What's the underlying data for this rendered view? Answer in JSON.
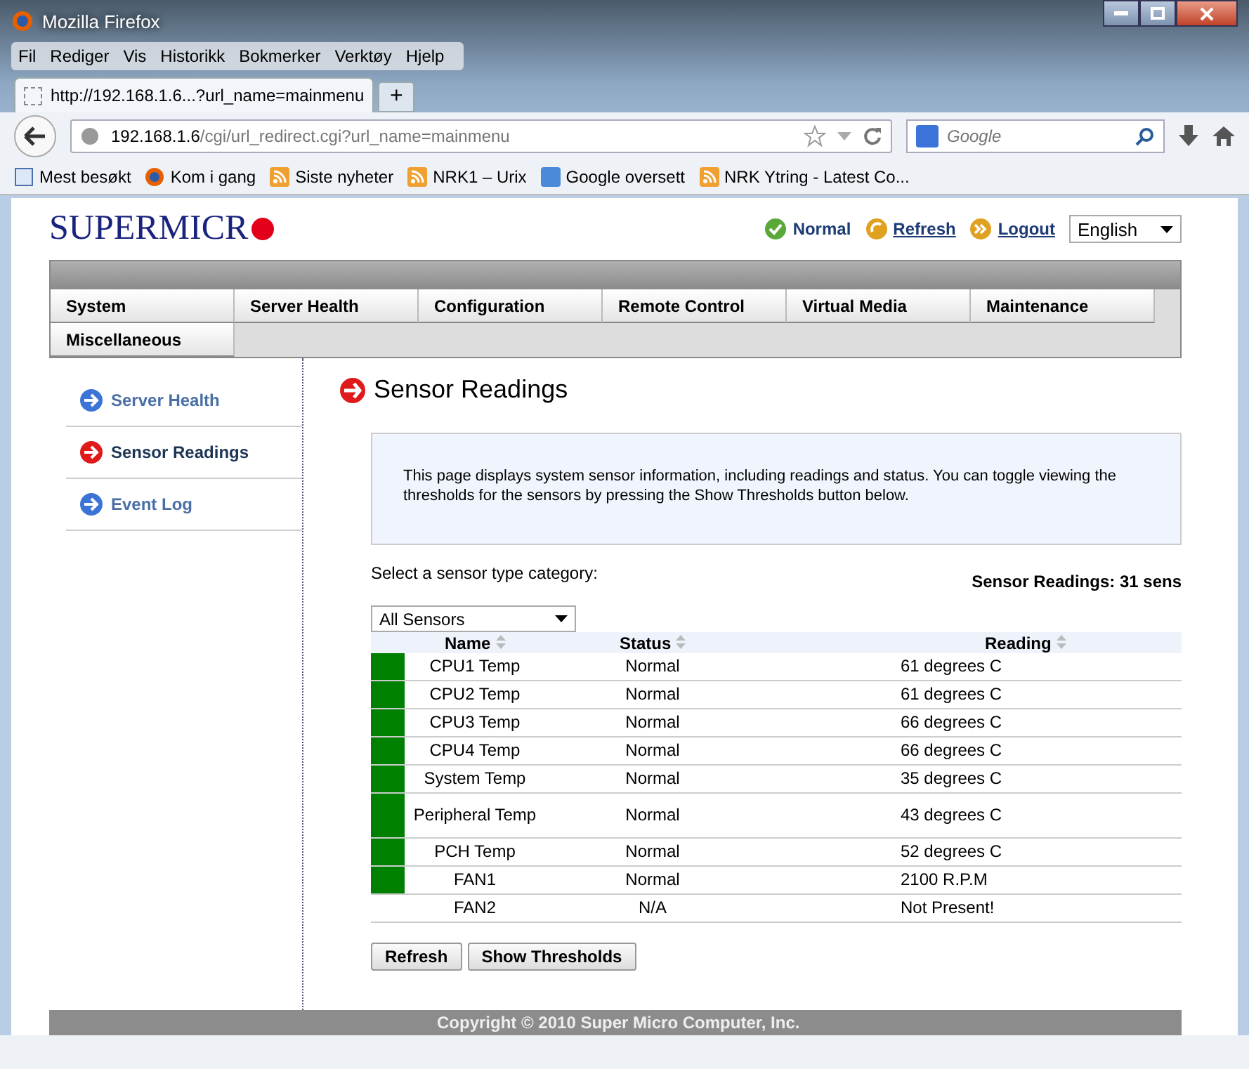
{
  "window": {
    "title": "Mozilla Firefox"
  },
  "menu": [
    "Fil",
    "Rediger",
    "Vis",
    "Historikk",
    "Bokmerker",
    "Verktøy",
    "Hjelp"
  ],
  "tab": {
    "title": "http://192.168.1.6...?url_name=mainmenu",
    "new_tab": "+"
  },
  "address": {
    "host": "192.168.1.6",
    "path": "/cgi/url_redirect.cgi?url_name=mainmenu"
  },
  "search": {
    "placeholder": "Google"
  },
  "bookmarks": [
    {
      "label": "Mest besøkt",
      "kind": "page"
    },
    {
      "label": "Kom i gang",
      "kind": "firefox"
    },
    {
      "label": "Siste nyheter",
      "kind": "feed"
    },
    {
      "label": "NRK1 – Urix",
      "kind": "feed"
    },
    {
      "label": "Google oversett",
      "kind": "translate"
    },
    {
      "label": "NRK Ytring - Latest Co...",
      "kind": "feed"
    }
  ],
  "header": {
    "logo": "SUPERMICR",
    "status": "Normal",
    "refresh": "Refresh",
    "logout": "Logout",
    "language": "English"
  },
  "nav": [
    "System",
    "Server Health",
    "Configuration",
    "Remote Control",
    "Virtual Media",
    "Maintenance",
    "Miscellaneous"
  ],
  "sidebar": {
    "items": [
      {
        "label": "Server Health",
        "selected": false
      },
      {
        "label": "Sensor Readings",
        "selected": true
      },
      {
        "label": "Event Log",
        "selected": false
      }
    ]
  },
  "main": {
    "title": "Sensor Readings",
    "info": "This page displays system sensor information, including readings and status. You can toggle viewing the thresholds for the sensors by pressing the Show Thresholds button below.",
    "category_label": "Select a sensor type category:",
    "count": "Sensor Readings: 31 sens",
    "category": "All Sensors"
  },
  "table": {
    "columns": [
      "Name",
      "Status",
      "Reading"
    ],
    "rows": [
      {
        "name": "CPU1 Temp",
        "status": "Normal",
        "reading": "61 degrees C",
        "color": "#008000"
      },
      {
        "name": "CPU2 Temp",
        "status": "Normal",
        "reading": "61 degrees C",
        "color": "#008000"
      },
      {
        "name": "CPU3 Temp",
        "status": "Normal",
        "reading": "66 degrees C",
        "color": "#008000"
      },
      {
        "name": "CPU4 Temp",
        "status": "Normal",
        "reading": "66 degrees C",
        "color": "#008000"
      },
      {
        "name": "System Temp",
        "status": "Normal",
        "reading": "35 degrees C",
        "color": "#008000"
      },
      {
        "name": "Peripheral Temp",
        "status": "Normal",
        "reading": "43 degrees C",
        "color": "#008000"
      },
      {
        "name": "PCH Temp",
        "status": "Normal",
        "reading": "52 degrees C",
        "color": "#008000"
      },
      {
        "name": "FAN1",
        "status": "Normal",
        "reading": "2100 R.P.M",
        "color": "#008000"
      },
      {
        "name": "FAN2",
        "status": "N/A",
        "reading": "Not Present!"
      }
    ]
  },
  "buttons": [
    "Refresh",
    "Show Thresholds"
  ],
  "footer": "Copyright © 2010 Super Micro Computer, Inc."
}
